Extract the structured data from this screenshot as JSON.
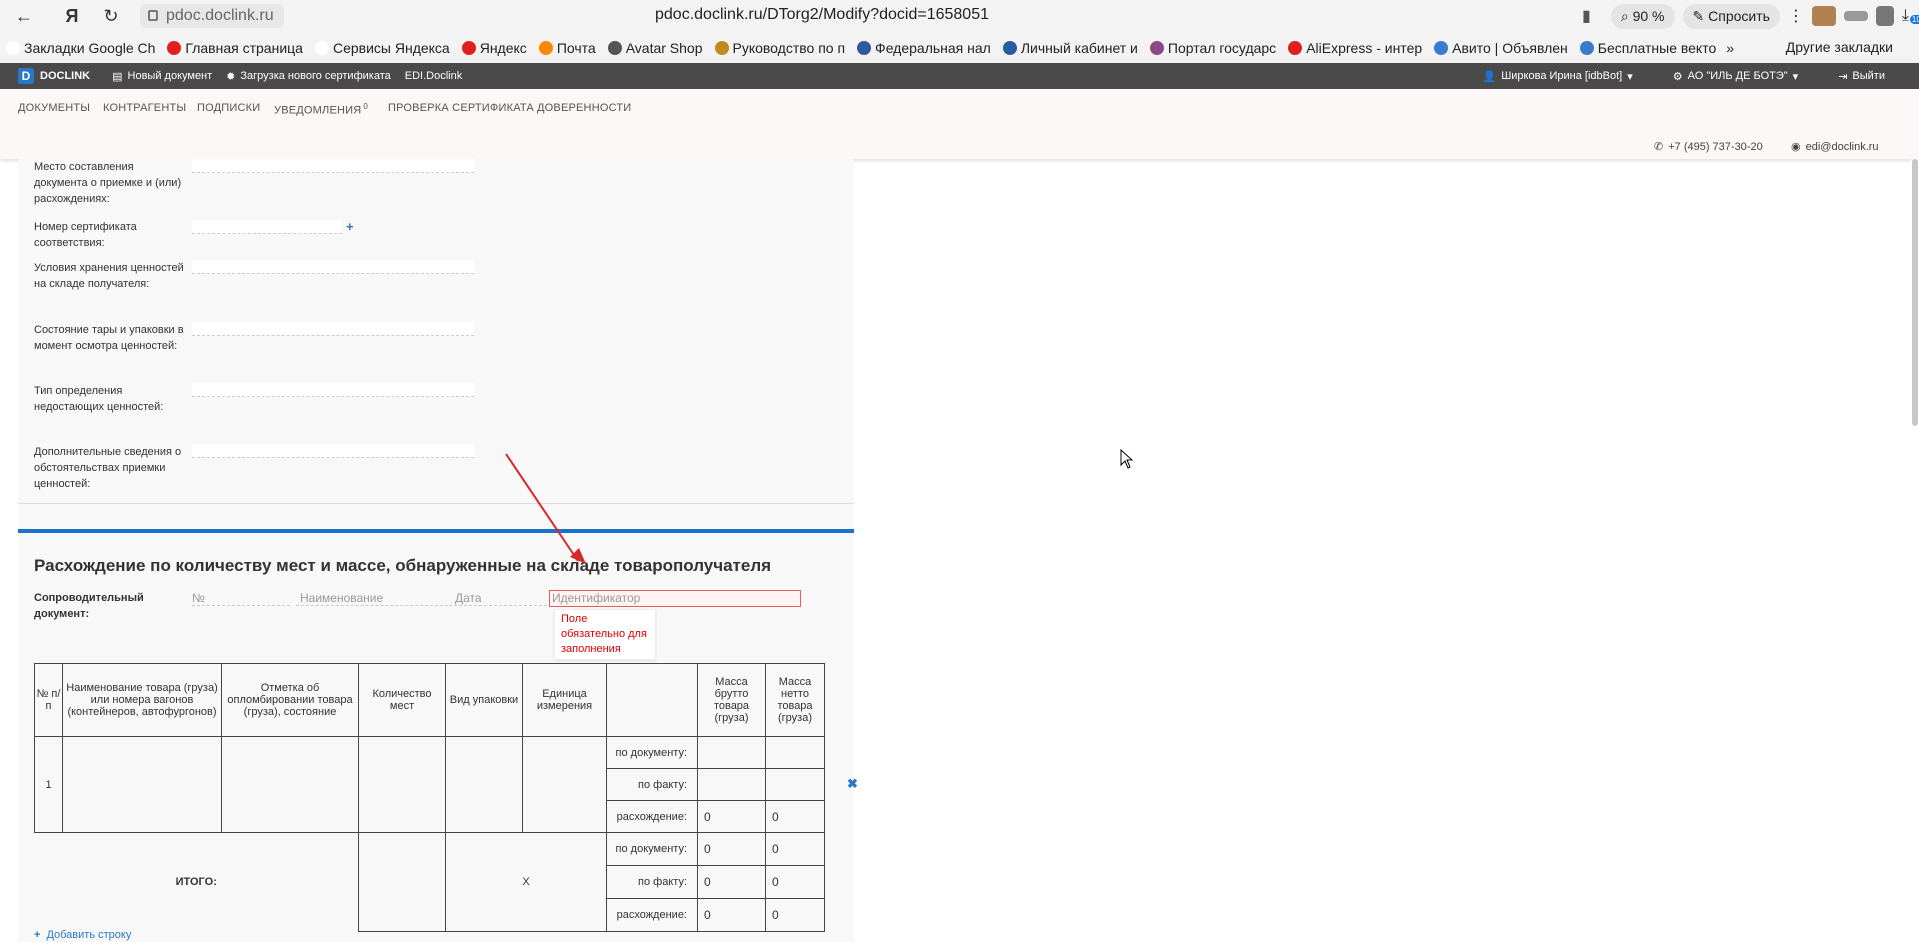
{
  "browser": {
    "host": "pdoc.doclink.ru",
    "title": "pdoc.doclink.ru/DTorg2/Modify?docid=1658051",
    "zoom": "90 %",
    "ask_label": "Спросить",
    "badge": "10"
  },
  "bookmarks": {
    "items": [
      {
        "label": "Закладки Google Ch",
        "color": "#ffffff"
      },
      {
        "label": "Главная страница",
        "color": "#e02020"
      },
      {
        "label": "Сервисы Яндекса",
        "color": "#ffffff"
      },
      {
        "label": "Яндекс",
        "color": "#e02020"
      },
      {
        "label": "Почта",
        "color": "#ff8800"
      },
      {
        "label": "Avatar Shop",
        "color": "#555555"
      },
      {
        "label": "Руководство по п",
        "color": "#c08a20"
      },
      {
        "label": "Федеральная нал",
        "color": "#2a5aa0"
      },
      {
        "label": "Личный кабинет и",
        "color": "#2a5aa0"
      },
      {
        "label": "Портал государс",
        "color": "#8a4a8a"
      },
      {
        "label": "AliExpress - интер",
        "color": "#e02020"
      },
      {
        "label": "Авито | Объявлен",
        "color": "#3a7ad0"
      },
      {
        "label": "Бесплатные векто",
        "color": "#3a7ad0"
      }
    ],
    "more": "»",
    "other": "Другие закладки"
  },
  "app": {
    "logo": "D",
    "brand": "DOCLINK",
    "new_doc": "Новый документ",
    "upload_cert": "Загрузка нового сертификата",
    "edi": "EDI.Doclink",
    "user": "Ширкова Ирина [idbBot]",
    "org": "АО \"ИЛЬ ДЕ БОТЭ\"",
    "logout": "Выйти"
  },
  "menu": {
    "documents": "ДОКУМЕНТЫ",
    "contractors": "КОНТРАГЕНТЫ",
    "signatures": "ПОДПИСКИ",
    "notifications": "УВЕДОМЛЕНИЯ",
    "notifications_count": "0",
    "cert_check": "ПРОВЕРКА СЕРТИФИКАТА",
    "powers": "ДОВЕРЕННОСТИ",
    "phone": "+7 (495) 737-30-20",
    "email": "edi@doclink.ru"
  },
  "form": {
    "place_label": "Место составления документа о приемке и (или) расхождениях:",
    "cert_label": "Номер сертификата соответствия:",
    "storage_label": "Условия хранения ценностей на складе получателя:",
    "packaging_label": "Состояние тары и упаковки в момент осмотра ценностей:",
    "shortage_label": "Тип определения недостающих ценностей:",
    "additional_label": "Дополнительные сведения о обстоятельствах приемки ценностей:"
  },
  "section": {
    "title": "Расхождение по количеству мест и массе, обнаруженные на складе товарополучателя",
    "accomp_label": "Сопроводительный документ:",
    "ph_number": "№",
    "ph_name": "Наименование",
    "ph_date": "Дата",
    "ph_id": "Идентификатор",
    "error": "Поле обязательно для заполнения"
  },
  "table": {
    "headers": {
      "num": "№ п/п",
      "name": "Наименование товара (груза) или номера вагонов (контейнеров, автофургонов)",
      "seal": "Отметка об опломбировании товара (груза), состояние",
      "places": "Количество мест",
      "pack": "Вид упаковки",
      "unit": "Единица измерения",
      "gross": "Масса брутто товара (груза)",
      "net": "Масса нетто товара (груза)"
    },
    "row_num": "1",
    "by_doc": "по документу:",
    "by_fact": "по факту:",
    "diff": "расхождение:",
    "diff_gross": "0",
    "diff_net": "0",
    "total_label": "ИТОГО:",
    "total_x": "X",
    "total_doc_gross": "0",
    "total_doc_net": "0",
    "total_fact_gross": "0",
    "total_fact_net": "0",
    "total_diff_gross": "0",
    "total_diff_net": "0",
    "add_row": "Добавить строку"
  }
}
